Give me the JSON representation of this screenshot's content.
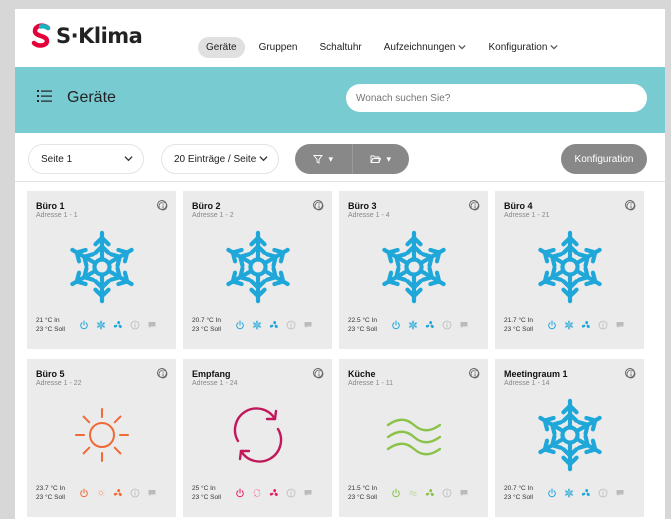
{
  "brand": {
    "name": "S·Klima"
  },
  "nav": [
    {
      "label": "Geräte",
      "active": true,
      "dropdown": false
    },
    {
      "label": "Gruppen",
      "active": false,
      "dropdown": false
    },
    {
      "label": "Schaltuhr",
      "active": false,
      "dropdown": false
    },
    {
      "label": "Aufzeichnungen",
      "active": false,
      "dropdown": true
    },
    {
      "label": "Konfiguration",
      "active": false,
      "dropdown": true
    }
  ],
  "header": {
    "title": "Geräte",
    "search_placeholder": "Wonach suchen Sie?"
  },
  "toolbar": {
    "page_select": "Seite 1",
    "entries_select": "20 Einträge / Seite",
    "config_button": "Konfiguration",
    "filter_icon": "filter-icon",
    "folder_icon": "folder-icon"
  },
  "colors": {
    "accent": "#79cbd2",
    "cool": "#1ea7d8",
    "heat": "#f06a35",
    "auto": "#c2185b",
    "dry": "#8bc34a",
    "mode_auto_icon": "#e91e63",
    "disabled": "#bbbbbb"
  },
  "devices": [
    {
      "name": "Büro 1",
      "address": "Adresse 1 - 1",
      "temp_in": "21 °C In",
      "temp_set": "23 °C Soll",
      "mode": "cool"
    },
    {
      "name": "Büro 2",
      "address": "Adresse 1 - 2",
      "temp_in": "20.7 °C In",
      "temp_set": "23 °C Soll",
      "mode": "cool"
    },
    {
      "name": "Büro 3",
      "address": "Adresse 1 - 4",
      "temp_in": "22.5 °C In",
      "temp_set": "23 °C Soll",
      "mode": "cool"
    },
    {
      "name": "Büro 4",
      "address": "Adresse 1 - 21",
      "temp_in": "21.7 °C In",
      "temp_set": "23 °C Soll",
      "mode": "cool"
    },
    {
      "name": "Büro 5",
      "address": "Adresse 1 - 22",
      "temp_in": "23.7 °C In",
      "temp_set": "23 °C Soll",
      "mode": "heat"
    },
    {
      "name": "Empfang",
      "address": "Adresse 1 - 24",
      "temp_in": "25 °C In",
      "temp_set": "23 °C Soll",
      "mode": "auto"
    },
    {
      "name": "Küche",
      "address": "Adresse 1 - 11",
      "temp_in": "21.5 °C In",
      "temp_set": "23 °C Soll",
      "mode": "dry"
    },
    {
      "name": "Meetingraum 1",
      "address": "Adresse 1 - 14",
      "temp_in": "20.7 °C In",
      "temp_set": "23 °C Soll",
      "mode": "cool"
    }
  ]
}
